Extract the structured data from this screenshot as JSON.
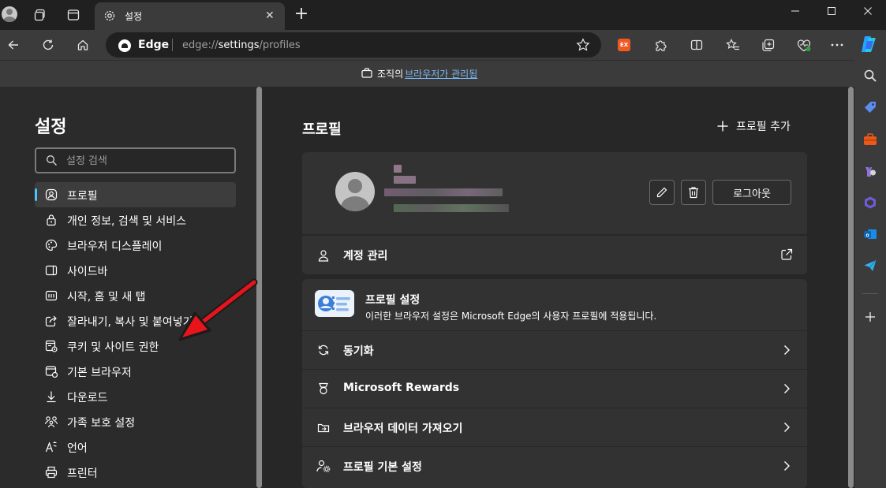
{
  "tab": {
    "title": "설정",
    "close": "✕"
  },
  "newtab_glyph": "+",
  "window_controls": {
    "minimize": "—",
    "maximize": "☐",
    "close": "✕"
  },
  "address": {
    "site_label": "Edge",
    "url_prefix": "edge://",
    "url_host": "settings",
    "url_path": "/profiles"
  },
  "extensions": {
    "orange_badge": "EX"
  },
  "banner": {
    "prefix": "조직의",
    "link": "브라우저가 관리됨"
  },
  "settings_nav": {
    "title": "설정",
    "search_placeholder": "설정 검색",
    "items": [
      {
        "label": "프로필",
        "icon": "profile-icon",
        "active": true
      },
      {
        "label": "개인 정보, 검색 및 서비스",
        "icon": "lock-icon"
      },
      {
        "label": "브라우저 디스플레이",
        "icon": "palette-icon"
      },
      {
        "label": "사이드바",
        "icon": "sidebar-icon"
      },
      {
        "label": "시작, 홈 및 새 탭",
        "icon": "home-tab-icon"
      },
      {
        "label": "잘라내기, 복사 및 붙여넣기",
        "icon": "share-icon"
      },
      {
        "label": "쿠키 및 사이트 권한",
        "icon": "cookie-icon"
      },
      {
        "label": "기본 브라우저",
        "icon": "browser-icon"
      },
      {
        "label": "다운로드",
        "icon": "download-icon"
      },
      {
        "label": "가족 보호 설정",
        "icon": "family-icon"
      },
      {
        "label": "언어",
        "icon": "language-icon"
      },
      {
        "label": "프린터",
        "icon": "printer-icon"
      }
    ]
  },
  "profile_page": {
    "title": "프로필",
    "add_profile": "프로필 추가",
    "logout": "로그아웃",
    "account_manage": "계정 관리",
    "settings_card": {
      "title": "프로필 설정",
      "subtitle": "이러한 브라우저 설정은 Microsoft Edge의 사용자 프로필에 적용됩니다.",
      "rows": [
        {
          "label": "동기화",
          "icon": "sync-icon"
        },
        {
          "label": "Microsoft Rewards",
          "icon": "rewards-icon"
        },
        {
          "label": "브라우저 데이터 가져오기",
          "icon": "import-icon"
        },
        {
          "label": "프로필 기본 설정",
          "icon": "profile-pref-icon"
        }
      ]
    }
  },
  "colors": {
    "accent": "#4cc2ff",
    "link": "#7fb9f5",
    "annotation_arrow": "#e8141b"
  }
}
